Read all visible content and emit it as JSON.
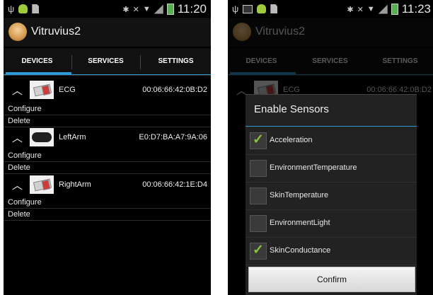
{
  "left": {
    "status": {
      "time": "11:20"
    },
    "app_title": "Vitruvius2",
    "tabs": [
      "DEVICES",
      "SERVICES",
      "SETTINGS"
    ],
    "devices": [
      {
        "name": "ECG",
        "mac": "00:06:66:42:0B:D2",
        "actions": [
          "Configure",
          "Delete"
        ]
      },
      {
        "name": "LeftArm",
        "mac": "E0:D7:BA:A7:9A:06",
        "actions": [
          "Configure",
          "Delete"
        ]
      },
      {
        "name": "RightArm",
        "mac": "00:06:66:42:1E:D4",
        "actions": [
          "Configure",
          "Delete"
        ]
      }
    ]
  },
  "right": {
    "status": {
      "time": "11:23"
    },
    "app_title": "Vitruvius2",
    "tabs": [
      "DEVICES",
      "SERVICES",
      "SETTINGS"
    ],
    "bg_device": {
      "name": "ECG",
      "mac": "00:06:66:42:0B:D2"
    },
    "dialog": {
      "title": "Enable Sensors",
      "options": [
        {
          "label": "Acceleration",
          "checked": true
        },
        {
          "label": "EnvironmentTemperature",
          "checked": false
        },
        {
          "label": "SkinTemperature",
          "checked": false
        },
        {
          "label": "EnvironmentLight",
          "checked": false
        },
        {
          "label": "SkinConductance",
          "checked": true
        }
      ],
      "confirm_label": "Confirm"
    }
  },
  "colors": {
    "accent": "#2f9ad6",
    "check": "#86c43c"
  }
}
